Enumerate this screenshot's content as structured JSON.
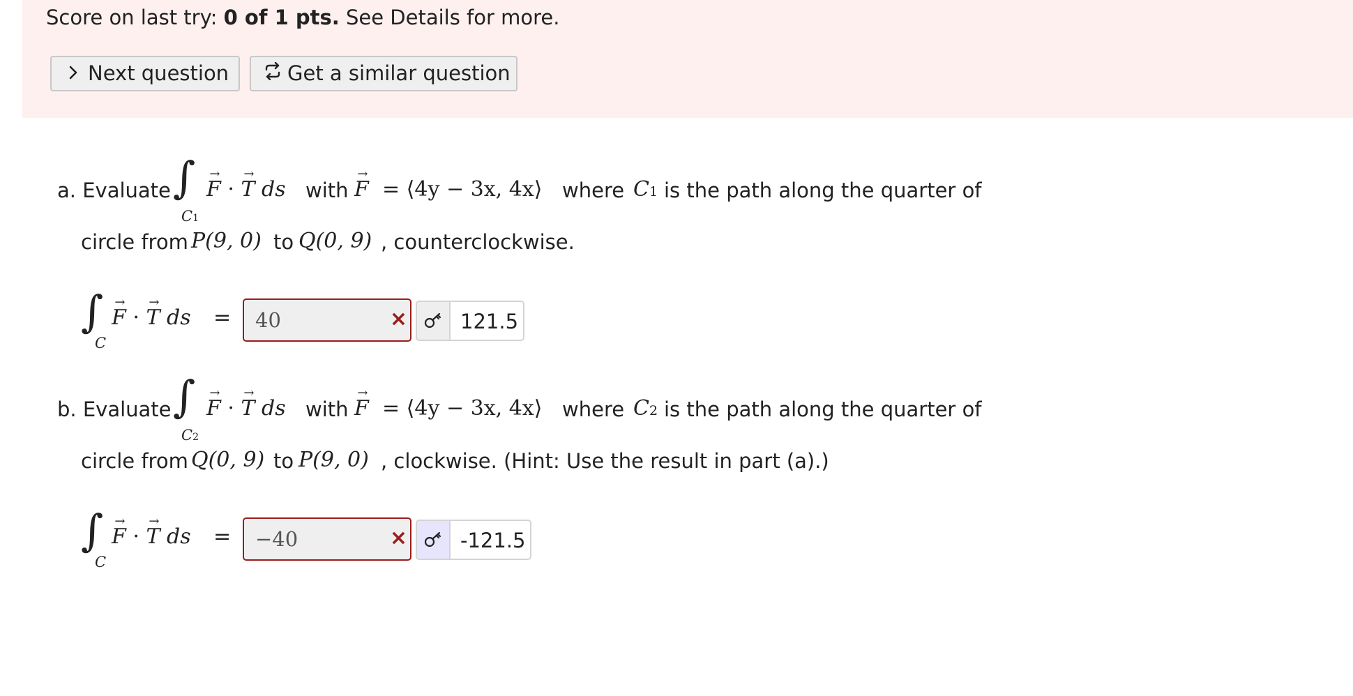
{
  "score": {
    "prefix": "Score on last try: ",
    "value": "0 of 1 pts.",
    "suffix": " See Details for more."
  },
  "buttons": {
    "next_icon": "chevron-right-icon",
    "next_label": "Next question",
    "similar_icon": "repeat-icon",
    "similar_label": "Get a similar question"
  },
  "part_a": {
    "label": "a. Evaluate",
    "integral_sub": "C",
    "integral_sub_index": "1",
    "with_text": "with",
    "F_def": "= ⟨4y − 3x, 4x⟩",
    "where_text": "where",
    "curve": "C",
    "curve_index": "1",
    "after_curve": "is the path along the quarter of",
    "line2_prefix": "circle from",
    "point1": "P(9, 0)",
    "to_text": "to",
    "point2": "Q(0, 9)",
    "line2_suffix": ", counterclockwise.",
    "lhs_sub": "C",
    "equals": "=",
    "student_answer": "40",
    "correct_answer": "121.5"
  },
  "part_b": {
    "label": "b. Evaluate",
    "integral_sub": "C",
    "integral_sub_index": "2",
    "with_text": "with",
    "F_def": "= ⟨4y − 3x, 4x⟩",
    "where_text": "where",
    "curve": "C",
    "curve_index": "2",
    "after_curve": "is the path along the quarter of",
    "line2_prefix": "circle from",
    "point1": "Q(0, 9)",
    "to_text": "to",
    "point2": "P(9, 0)",
    "line2_suffix": ", clockwise. (Hint: Use the result in part (a).)",
    "lhs_sub": "C",
    "equals": "=",
    "student_answer": "−40",
    "correct_answer": "-121.5"
  },
  "colors": {
    "banner_bg": "#fdf0ef",
    "wrong": "#9b1c1c",
    "key_active": "#e7e5fb"
  }
}
